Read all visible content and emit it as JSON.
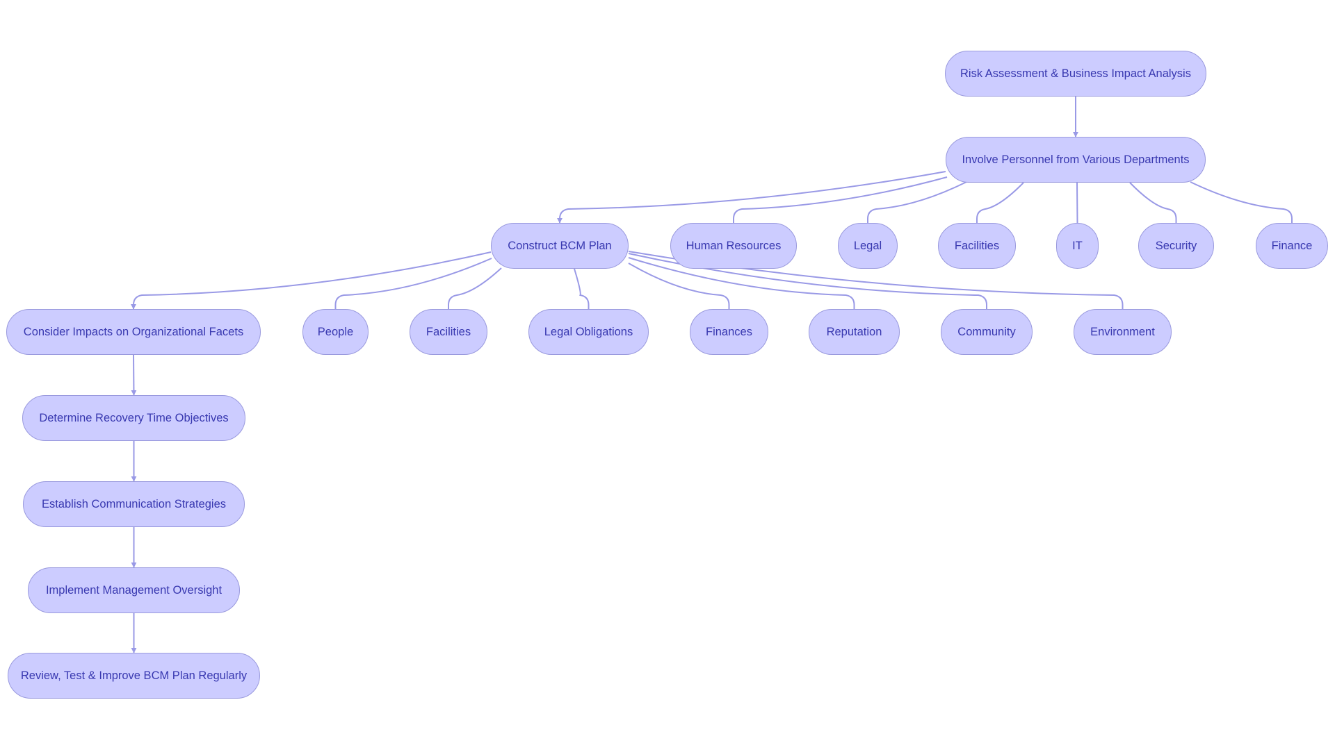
{
  "diagram": {
    "type": "flowchart",
    "colors": {
      "node_fill": "#ccccff",
      "node_stroke": "#9999dd",
      "node_text": "#3838b0",
      "edge": "#9999e6"
    },
    "nodes": [
      {
        "id": "risk",
        "label": "Risk Assessment & Business Impact Analysis"
      },
      {
        "id": "involve",
        "label": "Involve Personnel from Various Departments"
      },
      {
        "id": "construct",
        "label": "Construct BCM Plan"
      },
      {
        "id": "hr",
        "label": "Human Resources"
      },
      {
        "id": "legal",
        "label": "Legal"
      },
      {
        "id": "facilities1",
        "label": "Facilities"
      },
      {
        "id": "it",
        "label": "IT"
      },
      {
        "id": "security",
        "label": "Security"
      },
      {
        "id": "finance",
        "label": "Finance"
      },
      {
        "id": "consider",
        "label": "Consider Impacts on Organizational Facets"
      },
      {
        "id": "people",
        "label": "People"
      },
      {
        "id": "facilities2",
        "label": "Facilities"
      },
      {
        "id": "legalobl",
        "label": "Legal Obligations"
      },
      {
        "id": "finances",
        "label": "Finances"
      },
      {
        "id": "reputation",
        "label": "Reputation"
      },
      {
        "id": "community",
        "label": "Community"
      },
      {
        "id": "environment",
        "label": "Environment"
      },
      {
        "id": "rto",
        "label": "Determine Recovery Time Objectives"
      },
      {
        "id": "comm",
        "label": "Establish Communication Strategies"
      },
      {
        "id": "oversight",
        "label": "Implement Management Oversight"
      },
      {
        "id": "review",
        "label": "Review, Test & Improve BCM Plan Regularly"
      }
    ],
    "edges": [
      {
        "from": "risk",
        "to": "involve",
        "arrow": true
      },
      {
        "from": "involve",
        "to": "construct",
        "arrow": true
      },
      {
        "from": "involve",
        "to": "hr",
        "arrow": false
      },
      {
        "from": "involve",
        "to": "legal",
        "arrow": false
      },
      {
        "from": "involve",
        "to": "facilities1",
        "arrow": false
      },
      {
        "from": "involve",
        "to": "it",
        "arrow": false
      },
      {
        "from": "involve",
        "to": "security",
        "arrow": false
      },
      {
        "from": "involve",
        "to": "finance",
        "arrow": false
      },
      {
        "from": "construct",
        "to": "consider",
        "arrow": true
      },
      {
        "from": "construct",
        "to": "people",
        "arrow": false
      },
      {
        "from": "construct",
        "to": "facilities2",
        "arrow": false
      },
      {
        "from": "construct",
        "to": "legalobl",
        "arrow": false
      },
      {
        "from": "construct",
        "to": "finances",
        "arrow": false
      },
      {
        "from": "construct",
        "to": "reputation",
        "arrow": false
      },
      {
        "from": "construct",
        "to": "community",
        "arrow": false
      },
      {
        "from": "construct",
        "to": "environment",
        "arrow": false
      },
      {
        "from": "consider",
        "to": "rto",
        "arrow": true
      },
      {
        "from": "rto",
        "to": "comm",
        "arrow": true
      },
      {
        "from": "comm",
        "to": "oversight",
        "arrow": true
      },
      {
        "from": "oversight",
        "to": "review",
        "arrow": true
      }
    ]
  }
}
